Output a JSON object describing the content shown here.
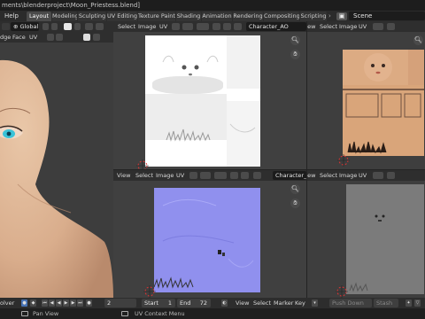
{
  "window": {
    "title": "ments\\blenderproject\\Moon_Priestess.blend]"
  },
  "topbar": {
    "help": "Help",
    "workspaces": [
      "Layout",
      "Modeling",
      "Sculpting",
      "UV Editing",
      "Texture Paint",
      "Shading",
      "Animation",
      "Rendering",
      "Compositing",
      "Scripting"
    ],
    "active_workspace": "Layout",
    "scene": "Scene"
  },
  "viewport3d": {
    "orientation": "Global",
    "edge_label": "dge",
    "face_label": "Face",
    "uv_label": "UV"
  },
  "uv_top": {
    "menus": [
      "Select",
      "Image",
      "UV"
    ],
    "image_name": "Character_AO"
  },
  "uv_bottom": {
    "menus": [
      "View",
      "Select",
      "Image",
      "UV"
    ],
    "image_name": "Character_No"
  },
  "image_right_top": {
    "menus": [
      "View",
      "Select",
      "Image",
      "UV"
    ]
  },
  "image_right_bottom": {
    "menus": [
      "View",
      "Select",
      "Image",
      "UV"
    ]
  },
  "timeline": {
    "solver_label": "olver",
    "current_frame": "2",
    "start_label": "Start",
    "start": "1",
    "end_label": "End",
    "end": "72",
    "menus": [
      "View",
      "Select",
      "Marker",
      "Key"
    ],
    "push_down": "Push Down",
    "stash": "Stash"
  },
  "status": {
    "pan_view": "Pan View",
    "uv_context_menu": "UV Context Menu"
  },
  "colors": {
    "accent": "#4772b3",
    "ao_background": "#ffffff",
    "diffuse_skin": "#d9a57a",
    "normal_map": "#8f8ff0",
    "gray_map": "#7b7b7b",
    "viewport_bg": "#3d3d3d"
  },
  "icons": [
    "globe-icon",
    "snap-icon",
    "sphere-shading-icon",
    "pin-icon",
    "hand-icon",
    "camera-icon",
    "play-icon",
    "record-icon",
    "mouse-icon"
  ]
}
